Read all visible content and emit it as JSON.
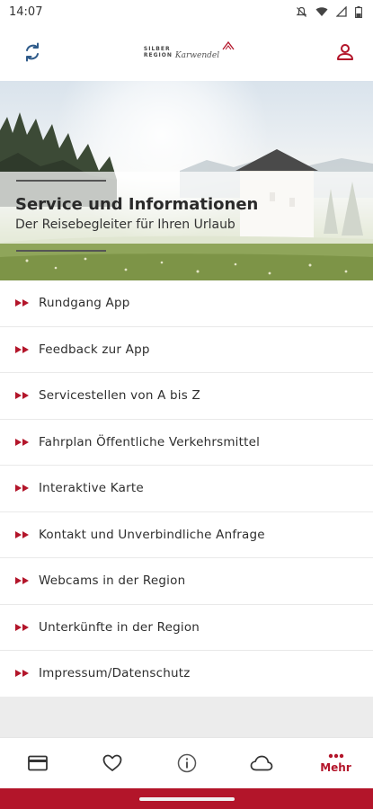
{
  "status_bar": {
    "time": "14:07",
    "icons": [
      "mute-icon",
      "wifi-icon",
      "signal-icon",
      "battery-icon"
    ]
  },
  "header": {
    "left_icon": "sync-icon",
    "right_icon": "user-icon",
    "logo": {
      "line1": "SILBER",
      "line2": "REGION",
      "script": "Karwendel"
    }
  },
  "hero": {
    "title": "Service und Informationen",
    "subtitle": "Der Reisebegleiter für Ihren Urlaub"
  },
  "menu": {
    "arrow_color": "#b3152a",
    "items": [
      {
        "label": "Rundgang App"
      },
      {
        "label": "Feedback zur App"
      },
      {
        "label": "Servicestellen von A bis Z"
      },
      {
        "label": "Fahrplan Öffentliche Verkehrsmittel"
      },
      {
        "label": "Interaktive Karte"
      },
      {
        "label": "Kontakt und Unverbindliche Anfrage"
      },
      {
        "label": "Webcams in der Region"
      },
      {
        "label": "Unterkünfte in der Region"
      },
      {
        "label": "Impressum/Datenschutz"
      }
    ]
  },
  "bottom_nav": {
    "items": [
      {
        "icon": "card-icon",
        "label": ""
      },
      {
        "icon": "heart-icon",
        "label": ""
      },
      {
        "icon": "info-icon",
        "label": ""
      },
      {
        "icon": "cloud-icon",
        "label": ""
      },
      {
        "icon": "more-icon",
        "label": "Mehr",
        "active": true
      }
    ],
    "accent": "#b3152a"
  }
}
